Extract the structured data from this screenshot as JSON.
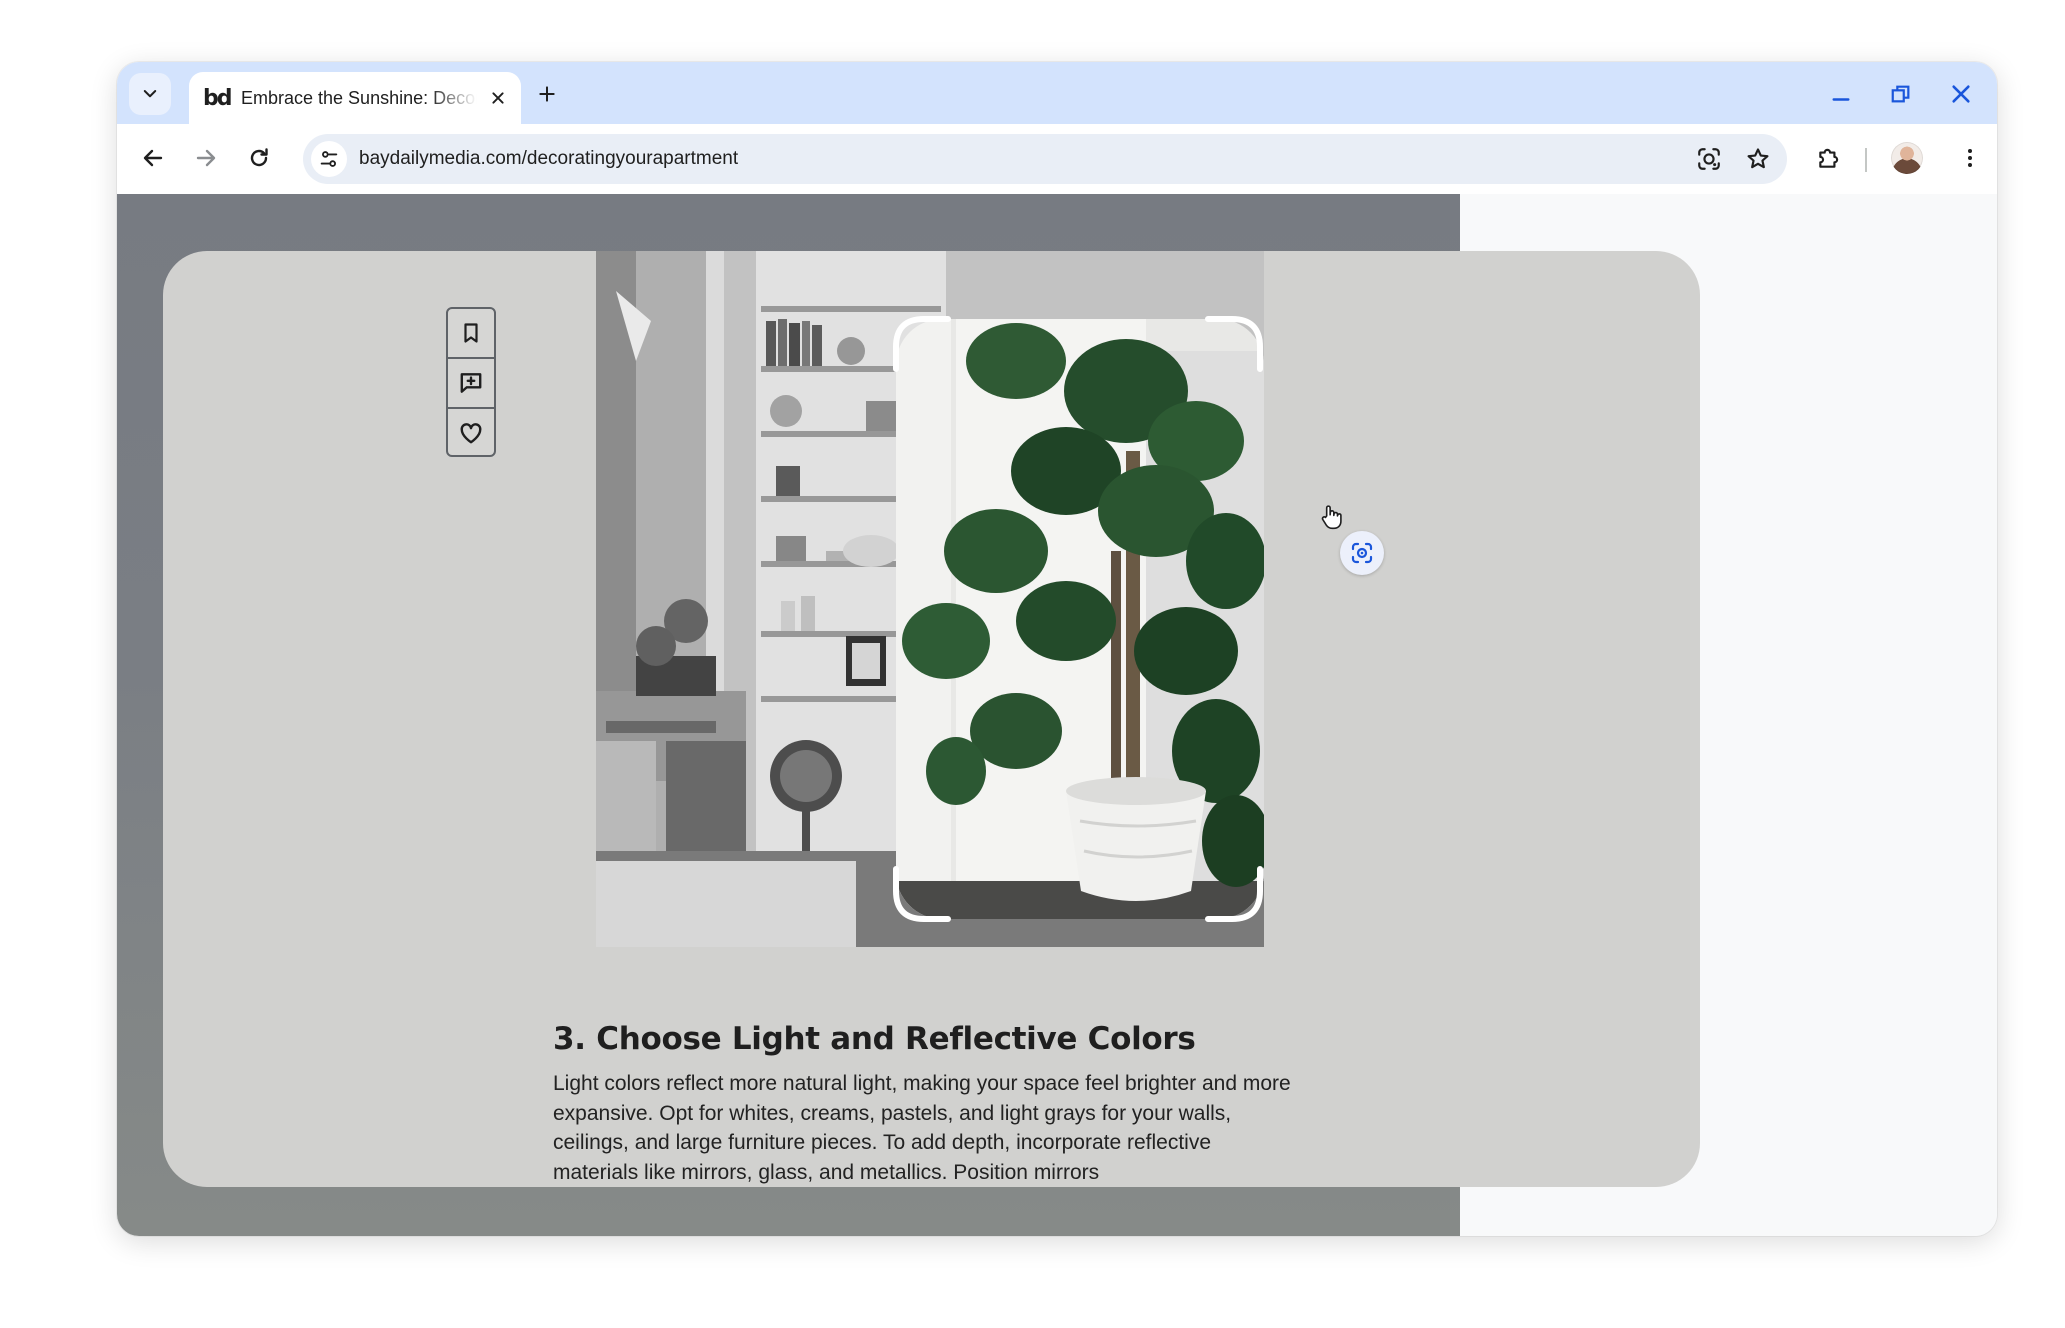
{
  "tab": {
    "favicon_text": "bd",
    "title": "Embrace the Sunshine: Decorating Your Apartment"
  },
  "address_bar": {
    "url": "baydailymedia.com/decoratingyourapartment"
  },
  "icons": {
    "tab_search": "chevron-down-icon",
    "tab_close": "close-icon",
    "new_tab": "plus-icon",
    "minimize": "minimize-icon",
    "restore": "restore-icon",
    "close_window": "close-icon",
    "back": "arrow-left-icon",
    "forward": "arrow-right-icon",
    "reload": "reload-icon",
    "site_info": "tune-icon",
    "google_lens": "lens-icon",
    "bookmark_star": "star-icon",
    "extensions": "puzzle-icon",
    "profile": "avatar",
    "menu": "kebab-icon",
    "rail_bookmark": "bookmark-icon",
    "rail_comment": "comment-add-icon",
    "rail_like": "heart-icon",
    "cursor": "hand-cursor-icon"
  },
  "article": {
    "heading": "3. Choose Light and Reflective Colors",
    "body": "Light colors reflect more natural light, making your space feel brighter and more expansive. Opt for whites, creams, pastels, and light grays for your walls, ceilings, and large furniture pieces. To add depth, incorporate reflective materials like mirrors, glass, and metallics. Position mirrors"
  },
  "colors": {
    "tab_strip": "#d3e3fd",
    "accent_blue": "#1a56db",
    "overlay_dim": "#7a7e84",
    "card": "#d1d1cf"
  }
}
